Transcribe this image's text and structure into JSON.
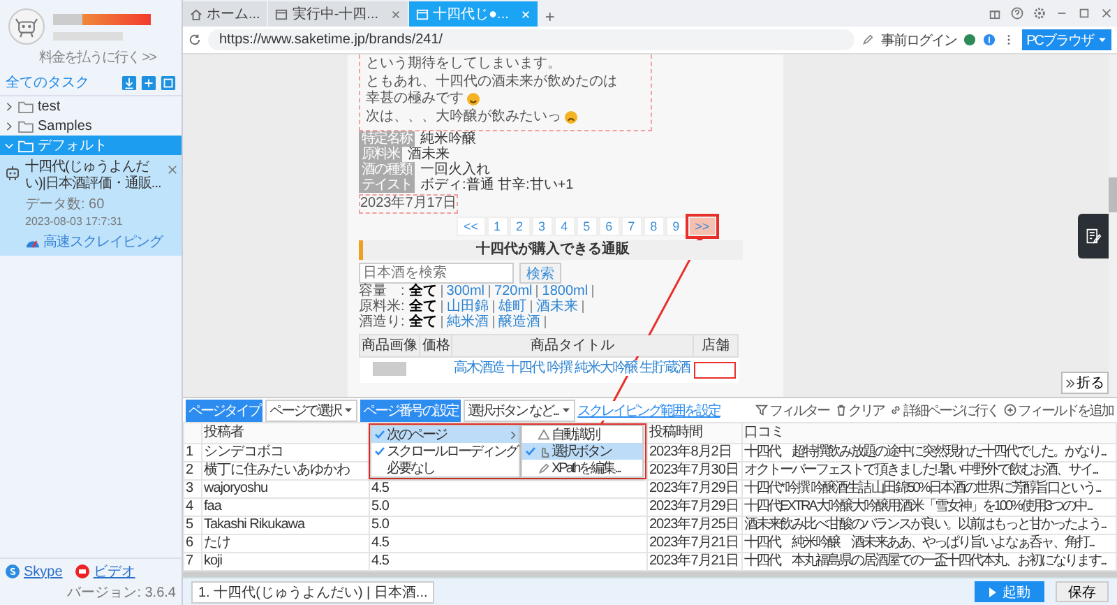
{
  "sidebar": {
    "upgrade_link": "料金を払うに行く >>",
    "all_tasks": "全てのタスク",
    "tree": [
      {
        "label": "test",
        "expanded": false,
        "selected": false
      },
      {
        "label": "Samples",
        "expanded": false,
        "selected": false
      },
      {
        "label": "デフォルト",
        "expanded": true,
        "selected": true,
        "tasks": [
          {
            "title": "十四代(じゅうよんだい)|日本酒評価・通販...",
            "count": "データ数: 60",
            "time": "2023-08-03 17:7:31",
            "mode": "高速スクレイピング"
          }
        ]
      }
    ],
    "links": [
      {
        "label": "Skype",
        "kind": "skype"
      },
      {
        "label": "ビデオ",
        "kind": "video"
      }
    ],
    "version": "バージョン: 3.6.4"
  },
  "browser": {
    "tabs": [
      {
        "label": "ホーム...",
        "kind": "home",
        "selected": false
      },
      {
        "label": "実行中-十四...",
        "kind": "page",
        "selected": false
      },
      {
        "label": "十四代じ●...",
        "kind": "page",
        "selected": true
      }
    ],
    "new_tab": "+",
    "url": "https://www.saketime.jp/brands/241/",
    "login": "事前ログイン",
    "mode_button": "PCブラウザ"
  },
  "page": {
    "paragraphs": [
      [
        {
          "text": "という期待をしてしまいます。"
        }
      ],
      [
        {
          "text": "ともあれ、十四代の酒未来が飲めたのは"
        },
        {
          "text": "幸甚の極みです",
          "kind": "smile"
        }
      ],
      [
        {
          "text": "次は、、、大吟醸が飲みたいっ",
          "kind": "frown"
        }
      ]
    ],
    "specs": [
      {
        "label": "特定名称",
        "value": "純米吟醸"
      },
      {
        "label": "原料米",
        "value": "酒未来"
      },
      {
        "label": "酒の種類",
        "value": "一回火入れ"
      },
      {
        "label": "テイスト",
        "value": "ボディ:普通 甘辛:甘い+1"
      }
    ],
    "date": "2023年7月17日",
    "pager": [
      {
        "label": "<<",
        "highlighted": false
      },
      {
        "label": "1",
        "highlighted": false
      },
      {
        "label": "2",
        "highlighted": false
      },
      {
        "label": "3",
        "highlighted": false
      },
      {
        "label": "4",
        "highlighted": false
      },
      {
        "label": "5",
        "highlighted": false
      },
      {
        "label": "6",
        "highlighted": false
      },
      {
        "label": "7",
        "highlighted": false
      },
      {
        "label": "8",
        "highlighted": false
      },
      {
        "label": "9",
        "highlighted": false
      },
      {
        "label": ">>",
        "highlighted": true
      }
    ],
    "shop_heading": "十四代が購入できる通販",
    "search": {
      "placeholder": "日本酒を検索",
      "button": "検索"
    },
    "filters": [
      {
        "label": "容量　:",
        "options": [
          {
            "label": "全て",
            "selected": true
          },
          {
            "label": "300ml",
            "selected": false
          },
          {
            "label": "720ml",
            "selected": false
          },
          {
            "label": "1800ml",
            "selected": false
          }
        ]
      },
      {
        "label": "原料米:",
        "options": [
          {
            "label": "全て",
            "selected": true
          },
          {
            "label": "山田錦",
            "selected": false
          },
          {
            "label": "雄町",
            "selected": false
          },
          {
            "label": "酒未来",
            "selected": false
          }
        ]
      },
      {
        "label": "酒造り:",
        "options": [
          {
            "label": "全て",
            "selected": true
          },
          {
            "label": "純米酒",
            "selected": false
          },
          {
            "label": "醸造酒",
            "selected": false
          }
        ]
      }
    ],
    "products": {
      "columns": [
        "商品画像",
        "価格",
        "商品タイトル",
        "店舗"
      ],
      "rows": [
        {
          "title": "高木酒造 十四代 吟撰 純米大吟醸 生貯蔵酒"
        }
      ]
    },
    "collapse_button": "折る"
  },
  "panel": {
    "page_type_label": "ページタイプ",
    "page_type_value": "ページで選択",
    "paging_label": "ページ番号の設定",
    "paging_value": "選択ボタン など...",
    "range_link": "スクレイピング範囲を設定",
    "tools": [
      {
        "label": "フィルター",
        "kind": "filter"
      },
      {
        "label": "クリア",
        "kind": "clear"
      },
      {
        "label": "詳細ページに行く",
        "kind": "link"
      },
      {
        "label": "フィールドを追加",
        "kind": "add"
      }
    ],
    "paging_menu": [
      {
        "label": "次のページ",
        "checked": true,
        "highlighted": true,
        "has_submenu": true
      },
      {
        "label": "スクロールローディング",
        "checked": true,
        "highlighted": false,
        "has_submenu": false
      },
      {
        "label": "必要なし",
        "checked": false,
        "highlighted": false,
        "has_submenu": false
      }
    ],
    "submenu": [
      {
        "label": "自動識別",
        "kind": "auto",
        "checked": false,
        "highlighted": false
      },
      {
        "label": "選択ボタン",
        "kind": "click",
        "checked": true,
        "highlighted": true
      },
      {
        "label": "XPathを編集...",
        "kind": "edit",
        "checked": false,
        "highlighted": false
      }
    ],
    "table": {
      "columns": [
        "投稿者",
        "投稿時間",
        "口コミ"
      ],
      "rows": [
        {
          "index": "1",
          "author": "シンデコボコ",
          "time": "2023年8月2日",
          "review": "十四代　超特撰飲み放題の途中に突然現れた十四代でした。かなり..."
        },
        {
          "index": "2",
          "author": "横丁に住みたいあゆかわ",
          "time": "2023年7月30日",
          "review": "オクトーバーフェストで頂きました! 暑い中野外で飲むお酒、サイ..."
        },
        {
          "index": "3",
          "author": "wajoryoshu",
          "rating": "4.5",
          "time": "2023年7月29日",
          "review": "十四代* 吟撰 吟醸酒生詰 山田錦50%日本酒の世界に芳醇旨口という..."
        },
        {
          "index": "4",
          "author": "faa",
          "rating": "5.0",
          "time": "2023年7月29日",
          "review": "十四代EXTRA大吟醸大吟醸用酒米「雪女神」を100%使用3つの中..."
        },
        {
          "index": "5",
          "author": "Takashi Rikukawa",
          "rating": "5.0",
          "time": "2023年7月25日",
          "review": "酒未来飲み比べ甘酸のバランスが良い。以前はもっと甘かったよう..."
        },
        {
          "index": "6",
          "author": "たけ",
          "rating": "4.5",
          "time": "2023年7月21日",
          "review": "十四代　純米吟醸　酒未来ああ、やっぱり旨いよなぁ呑ャ、角打..."
        },
        {
          "index": "7",
          "author": "koji",
          "rating": "4.5",
          "time": "2023年7月21日",
          "review": "十四代　本丸福島県の居酒屋での一盃十四代本丸、お初になります..."
        }
      ]
    }
  },
  "footer": {
    "task_tab": "1. 十四代(じゅうよんだい) | 日本酒...",
    "start": "起動",
    "save": "保存"
  }
}
